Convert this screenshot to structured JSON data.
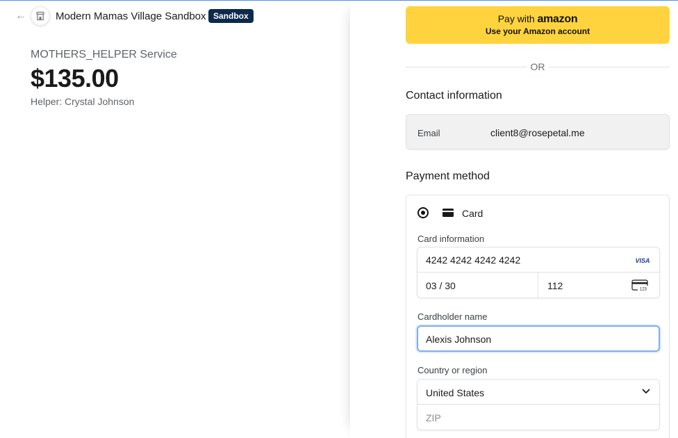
{
  "header": {
    "merchant_name": "Modern Mamas Village Sandbox",
    "badge": "Sandbox"
  },
  "summary": {
    "service": "MOTHERS_HELPER Service",
    "price": "$135.00",
    "helper": "Helper: Crystal Johnson"
  },
  "amazon_pay": {
    "prefix": "Pay with ",
    "brand": "amazon",
    "subtitle": "Use your Amazon account"
  },
  "divider": {
    "or": "OR"
  },
  "contact": {
    "heading": "Contact information",
    "email_label": "Email",
    "email_value": "client8@rosepetal.me"
  },
  "payment": {
    "heading": "Payment method",
    "card_option": "Card",
    "card_info_label": "Card information",
    "card_number": "4242 4242 4242 4242",
    "card_brand": "VISA",
    "expiry": "03 / 30",
    "cvc": "112",
    "cardholder_label": "Cardholder name",
    "cardholder_value": "Alexis Johnson",
    "country_label": "Country or region",
    "country_value": "United States",
    "zip_placeholder": "ZIP"
  },
  "icons": {
    "back": "arrow-left-icon",
    "merchant": "store-icon",
    "card": "credit-card-icon",
    "cvc": "cvc-card-icon",
    "chevron": "chevron-down-icon"
  },
  "colors": {
    "amazon_button": "#ffd33d",
    "badge_bg": "#0d2a4c",
    "focus_ring": "#7fb0e6"
  }
}
